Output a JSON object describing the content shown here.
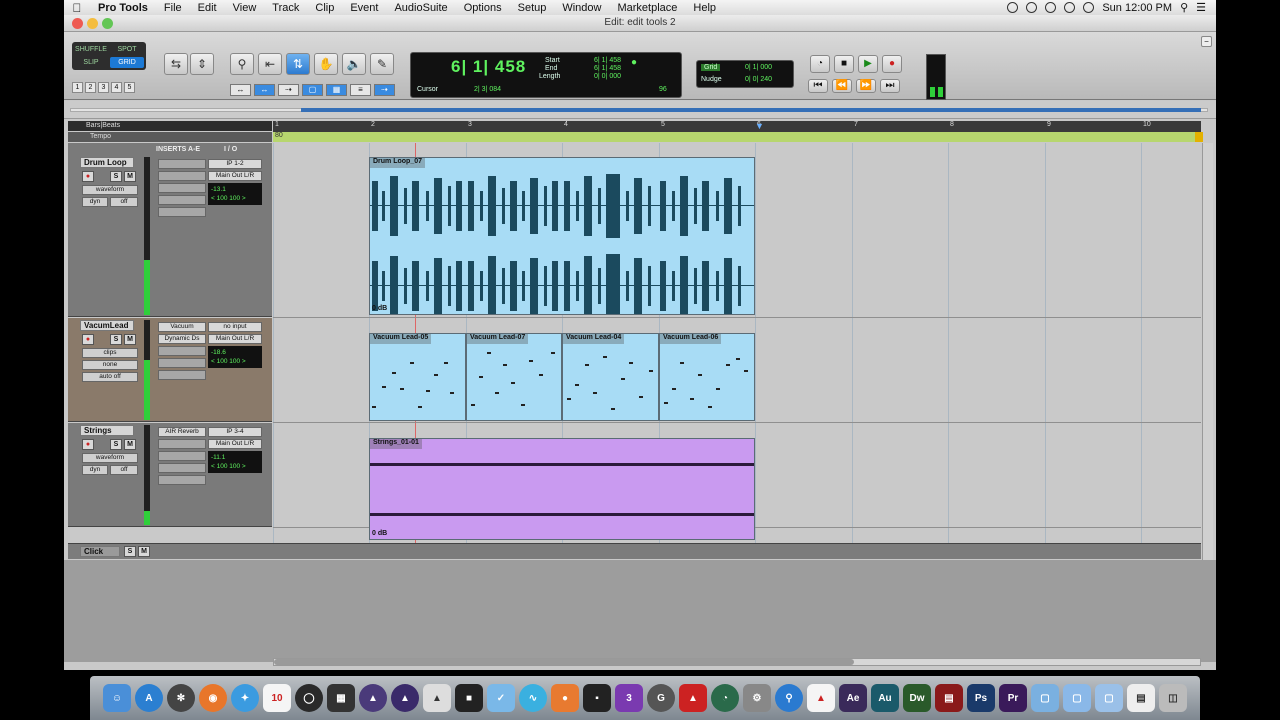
{
  "menubar": {
    "app_name": "Pro Tools",
    "items": [
      "File",
      "Edit",
      "View",
      "Track",
      "Clip",
      "Event",
      "AudioSuite",
      "Options",
      "Setup",
      "Window",
      "Marketplace",
      "Help"
    ],
    "clock": "Sun 12:00 PM"
  },
  "window": {
    "title": "Edit: edit tools 2"
  },
  "toolbar": {
    "modes": [
      "SHUFFLE",
      "SPOT",
      "SLIP",
      "GRID"
    ],
    "active_mode": "GRID",
    "zoom_presets": [
      "1",
      "2",
      "3",
      "4",
      "5"
    ],
    "counter": {
      "main": "6| 1| 458",
      "start_label": "Start",
      "start": "6| 1| 458",
      "end_label": "End",
      "end": "6| 1| 458",
      "length_label": "Length",
      "length": "0| 0| 000",
      "cursor_label": "Cursor",
      "cursor": "2| 3| 084",
      "tempo": "96"
    },
    "grid": {
      "label": "Grid",
      "value": "0| 1| 000"
    },
    "nudge": {
      "label": "Nudge",
      "value": "0| 0| 240"
    }
  },
  "rulers": {
    "bars_label": "Bars|Beats",
    "tempo_label": "Tempo",
    "tempo_value": "80",
    "bar_numbers": [
      "1",
      "2",
      "3",
      "4",
      "5",
      "6",
      "7",
      "8",
      "9",
      "10"
    ]
  },
  "columns": {
    "inserts": "INSERTS A-E",
    "io": "I / O"
  },
  "tracks": [
    {
      "name": "Drum Loop",
      "view": "waveform",
      "dyn": "dyn",
      "auto": "off",
      "inserts": [],
      "input": "IP 1-2",
      "output": "Main Out L/R",
      "vol": "-13.1",
      "pan_l": "< 100",
      "pan_r": "100 >",
      "clips": [
        {
          "name": "Drum Loop_07",
          "gain": "0 dB"
        }
      ]
    },
    {
      "name": "VacumLead",
      "view": "clips",
      "dyn": "none",
      "auto": "auto off",
      "inserts": [
        "Vacuum",
        "Dynamic Ds"
      ],
      "input": "no input",
      "output": "Main Out L/R",
      "vol": "-18.6",
      "pan_l": "< 100",
      "pan_r": "100 >",
      "clips": [
        {
          "name": "Vacuum Lead-05"
        },
        {
          "name": "Vacuum Lead-07"
        },
        {
          "name": "Vacuum Lead-04"
        },
        {
          "name": "Vacuum Lead-06"
        }
      ]
    },
    {
      "name": "Strings",
      "view": "waveform",
      "dyn": "dyn",
      "auto": "off",
      "inserts": [
        "AIR Reverb"
      ],
      "input": "IP 3-4",
      "output": "Main Out L/R",
      "vol": "-11.1",
      "pan_l": "< 100",
      "pan_r": "100 >",
      "clips": [
        {
          "name": "Strings_01-01",
          "gain": "0 dB"
        }
      ]
    }
  ],
  "click_track": {
    "name": "Click"
  },
  "colors": {
    "drum_clip": "#a8dcf5",
    "lead_clip": "#a8dcf5",
    "strings_clip": "#c99af0",
    "waveform": "#1b4a5e",
    "counter_text": "#5ff25f",
    "tempo_ruler": "#b7d66e"
  },
  "dock": {
    "icons": [
      "finder-icon",
      "appstore-icon",
      "launchpad-icon",
      "firefox-icon",
      "safari-icon",
      "calendar-icon",
      "dashboard-icon",
      "mixer-icon",
      "protools10-icon",
      "protools-icon",
      "utility-icon",
      "ilok-icon",
      "tools-icon",
      "audio-icon",
      "patch-icon",
      "terminal-icon",
      "plugin-icon",
      "grab-icon",
      "ikmultimedia-icon",
      "timemachine-icon",
      "prefs-icon",
      "network-icon",
      "acrobat-icon",
      "aftereffects-icon",
      "audition-icon",
      "dreamweaver-icon",
      "pdf-icon",
      "photoshop-icon",
      "premiere-icon",
      "folder-icon",
      "documents-icon",
      "downloads-icon",
      "file-icon",
      "trash-icon"
    ],
    "calendar_day": "10"
  }
}
